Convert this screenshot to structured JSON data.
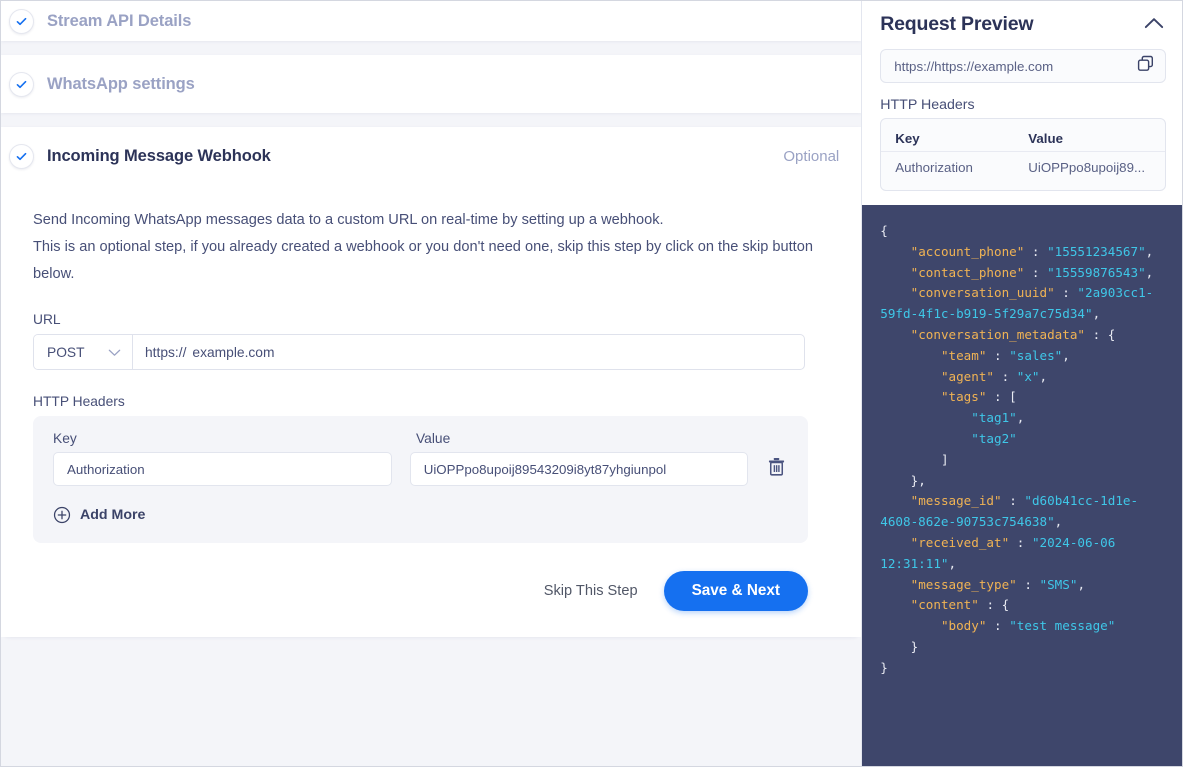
{
  "accordion": [
    {
      "title": "Stream API Details",
      "state": "completed",
      "optional": ""
    },
    {
      "title": "WhatsApp settings",
      "state": "completed",
      "optional": ""
    },
    {
      "title": "Incoming Message Webhook",
      "state": "active",
      "optional": "Optional"
    }
  ],
  "webhook": {
    "description_line1": "Send Incoming WhatsApp messages data to a custom URL on real-time by setting up a webhook.",
    "description_line2": "This is an optional step, if you already created a webhook or you don't need one, skip this step by click on the skip button below.",
    "url_label": "URL",
    "method": "POST",
    "url_prefix": "https://",
    "url_value": "example.com",
    "headers_label": "HTTP Headers",
    "col_key": "Key",
    "col_value": "Value",
    "rows": [
      {
        "key": "Authorization",
        "value": "UiOPPpo8upoij89543209i8yt87yhgiunpol"
      }
    ],
    "add_more_label": "Add More",
    "skip_label": "Skip This Step",
    "save_label": "Save & Next"
  },
  "preview": {
    "title": "Request Preview",
    "url": "https://https://example.com",
    "headers_label": "HTTP Headers",
    "col_key": "Key",
    "col_value": "Value",
    "rows": [
      {
        "key": "Authorization",
        "value": "UiOPPpo8upoij89..."
      }
    ],
    "code": [
      {
        "t": "p",
        "v": "{\n"
      },
      {
        "t": "p",
        "v": "    "
      },
      {
        "t": "k",
        "v": "\"account_phone\""
      },
      {
        "t": "p",
        "v": " : "
      },
      {
        "t": "s",
        "v": "\"15551234567\""
      },
      {
        "t": "p",
        "v": ",\n"
      },
      {
        "t": "p",
        "v": "    "
      },
      {
        "t": "k",
        "v": "\"contact_phone\""
      },
      {
        "t": "p",
        "v": " : "
      },
      {
        "t": "s",
        "v": "\"15559876543\""
      },
      {
        "t": "p",
        "v": ",\n"
      },
      {
        "t": "p",
        "v": "    "
      },
      {
        "t": "k",
        "v": "\"conversation_uuid\""
      },
      {
        "t": "p",
        "v": " : "
      },
      {
        "t": "s",
        "v": "\"2a903cc1-59fd-4f1c-b919-5f29a7c75d34\""
      },
      {
        "t": "p",
        "v": ",\n"
      },
      {
        "t": "p",
        "v": "    "
      },
      {
        "t": "k",
        "v": "\"conversation_metadata\""
      },
      {
        "t": "p",
        "v": " : {\n"
      },
      {
        "t": "p",
        "v": "        "
      },
      {
        "t": "k",
        "v": "\"team\""
      },
      {
        "t": "p",
        "v": " : "
      },
      {
        "t": "s",
        "v": "\"sales\""
      },
      {
        "t": "p",
        "v": ",\n"
      },
      {
        "t": "p",
        "v": "        "
      },
      {
        "t": "k",
        "v": "\"agent\""
      },
      {
        "t": "p",
        "v": " : "
      },
      {
        "t": "s",
        "v": "\"x\""
      },
      {
        "t": "p",
        "v": ",\n"
      },
      {
        "t": "p",
        "v": "        "
      },
      {
        "t": "k",
        "v": "\"tags\""
      },
      {
        "t": "p",
        "v": " : [\n"
      },
      {
        "t": "p",
        "v": "            "
      },
      {
        "t": "s",
        "v": "\"tag1\""
      },
      {
        "t": "p",
        "v": ",\n"
      },
      {
        "t": "p",
        "v": "            "
      },
      {
        "t": "s",
        "v": "\"tag2\""
      },
      {
        "t": "p",
        "v": "\n"
      },
      {
        "t": "p",
        "v": "        ]\n"
      },
      {
        "t": "p",
        "v": "    },\n"
      },
      {
        "t": "p",
        "v": "    "
      },
      {
        "t": "k",
        "v": "\"message_id\""
      },
      {
        "t": "p",
        "v": " : "
      },
      {
        "t": "s",
        "v": "\"d60b41cc-1d1e-4608-862e-90753c754638\""
      },
      {
        "t": "p",
        "v": ",\n"
      },
      {
        "t": "p",
        "v": "    "
      },
      {
        "t": "k",
        "v": "\"received_at\""
      },
      {
        "t": "p",
        "v": " : "
      },
      {
        "t": "s",
        "v": "\"2024-06-06 12:31:11\""
      },
      {
        "t": "p",
        "v": ",\n"
      },
      {
        "t": "p",
        "v": "    "
      },
      {
        "t": "k",
        "v": "\"message_type\""
      },
      {
        "t": "p",
        "v": " : "
      },
      {
        "t": "s",
        "v": "\"SMS\""
      },
      {
        "t": "p",
        "v": ",\n"
      },
      {
        "t": "p",
        "v": "    "
      },
      {
        "t": "k",
        "v": "\"content\""
      },
      {
        "t": "p",
        "v": " : {\n"
      },
      {
        "t": "p",
        "v": "        "
      },
      {
        "t": "k",
        "v": "\"body\""
      },
      {
        "t": "p",
        "v": " : "
      },
      {
        "t": "s",
        "v": "\"test message\""
      },
      {
        "t": "p",
        "v": "\n"
      },
      {
        "t": "p",
        "v": "    }\n"
      },
      {
        "t": "p",
        "v": "}"
      }
    ]
  },
  "colors": {
    "accent": "#1570f0",
    "code_bg": "#3e466b",
    "code_key": "#f0b354",
    "code_string": "#3fc7e8",
    "page_bg": "#f4f5f9",
    "heading": "#2c3358",
    "muted": "#9aa2c4"
  }
}
